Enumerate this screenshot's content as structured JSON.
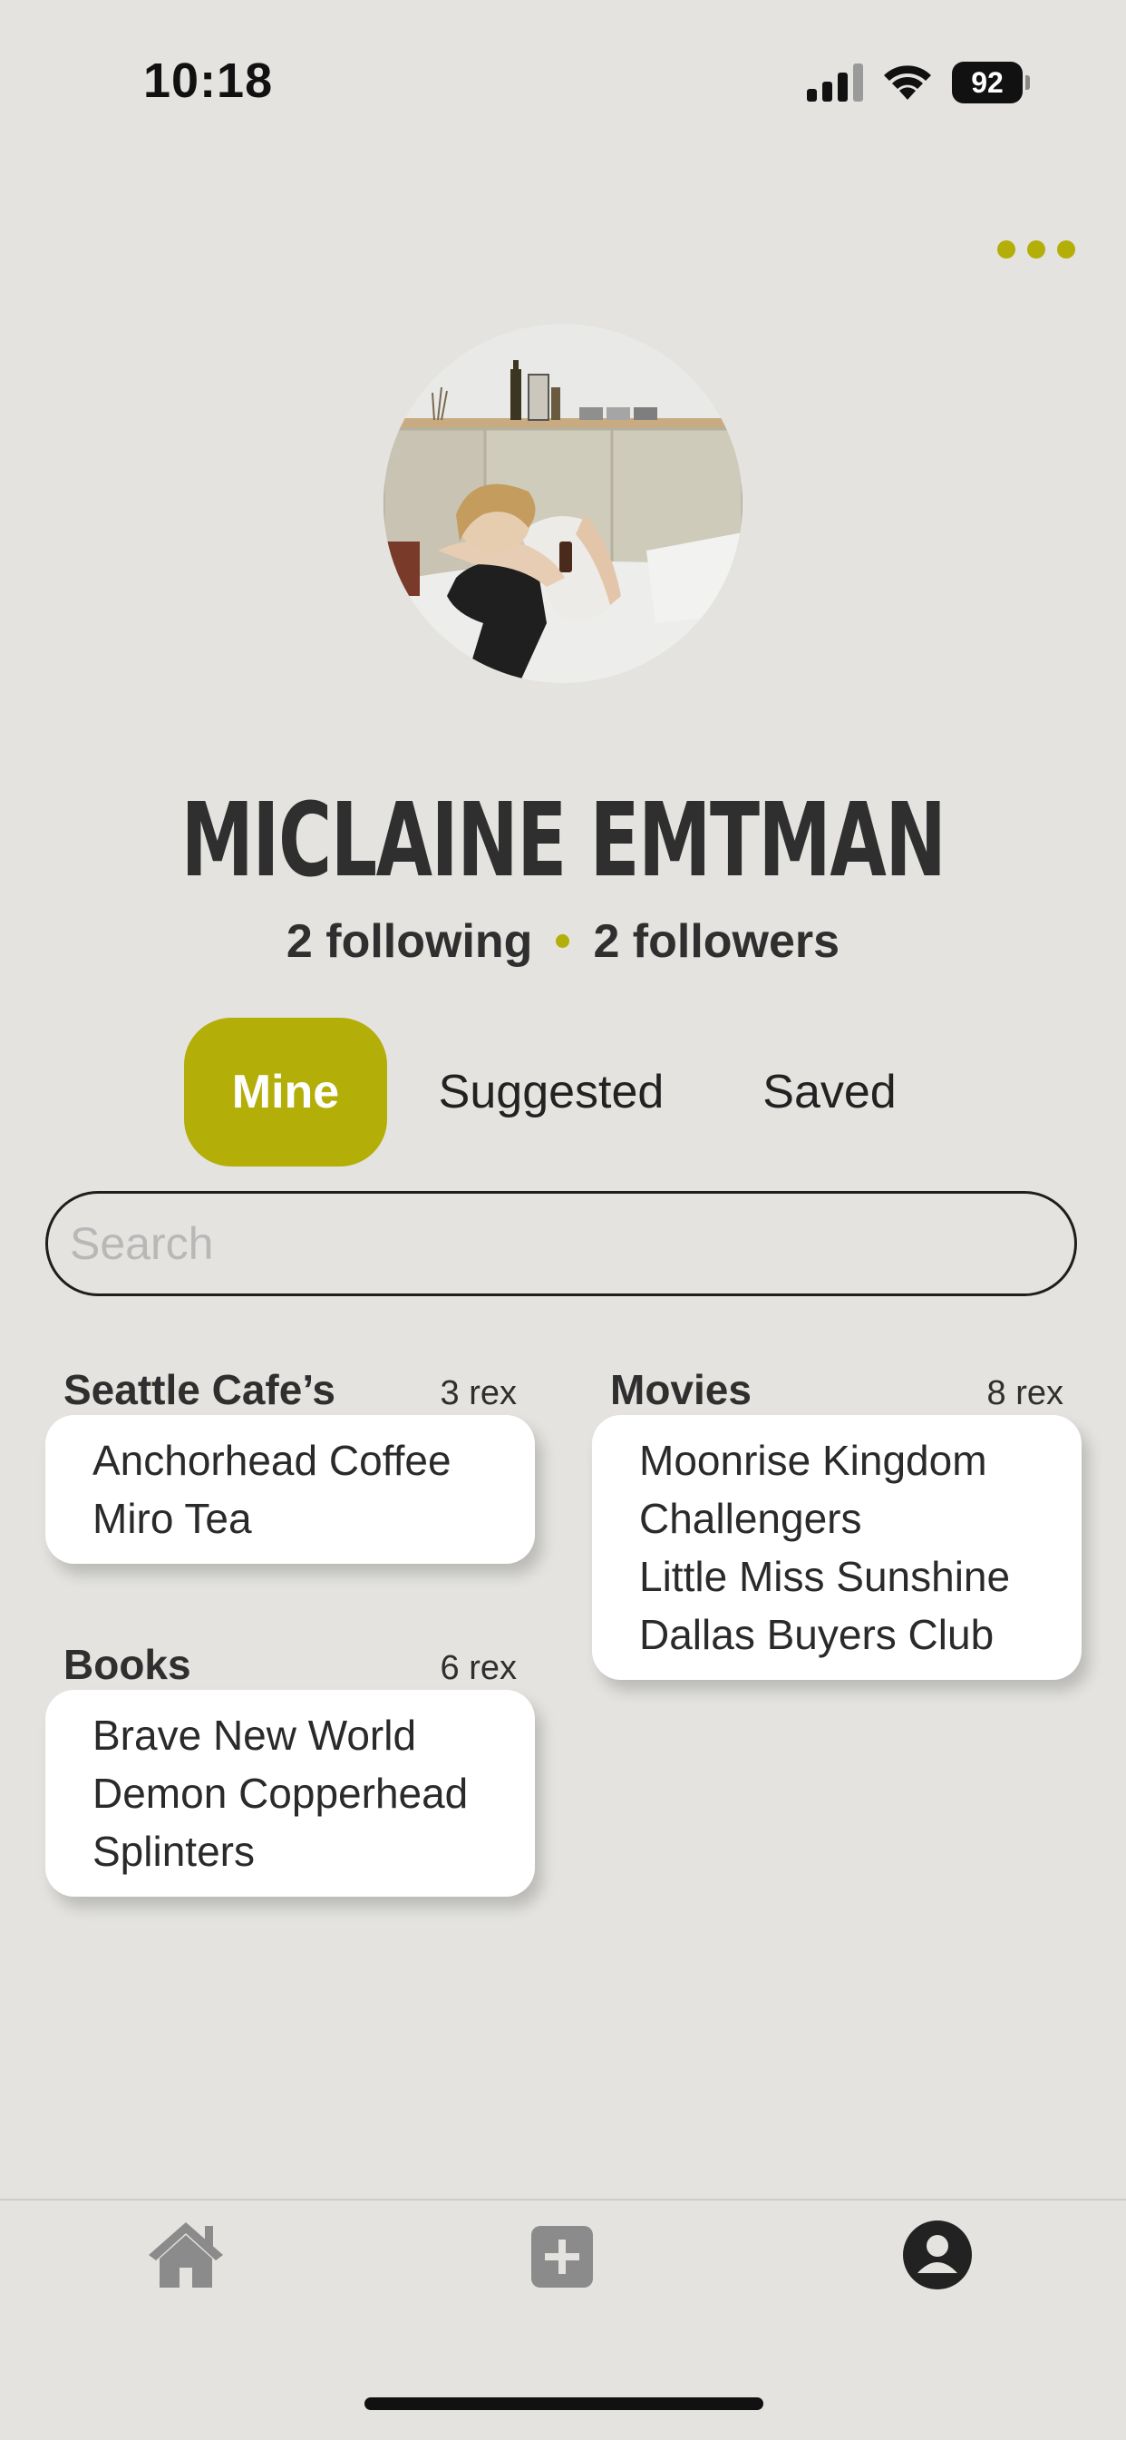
{
  "status_bar": {
    "time": "10:18",
    "battery": "92",
    "icons": [
      "signal-icon",
      "wifi-icon",
      "battery-icon"
    ]
  },
  "header": {
    "more_icon": "ellipsis-icon"
  },
  "profile": {
    "name": "MICLAINE EMTMAN",
    "following": "2 following",
    "followers": "2 followers"
  },
  "tabs": [
    {
      "label": "Mine",
      "active": true
    },
    {
      "label": "Suggested",
      "active": false
    },
    {
      "label": "Saved",
      "active": false
    }
  ],
  "search": {
    "placeholder": "Search",
    "value": ""
  },
  "collections": [
    {
      "title": "Seattle Cafe’s",
      "count": "3 rex",
      "items": [
        "Anchorhead Coffee",
        "Miro Tea"
      ]
    },
    {
      "title": "Movies",
      "count": "8 rex",
      "items": [
        "Moonrise Kingdom",
        "Challengers",
        "Little Miss Sunshine",
        "Dallas Buyers Club"
      ]
    },
    {
      "title": "Books",
      "count": "6 rex",
      "items": [
        "Brave New World",
        "Demon Copperhead",
        "Splinters"
      ]
    }
  ],
  "bottom_nav": {
    "items": [
      "home-icon",
      "add-icon",
      "profile-icon"
    ],
    "active": "profile-icon"
  },
  "colors": {
    "accent": "#b3ae08",
    "background": "#e4e3df",
    "card": "#ffffff",
    "text": "#2f2f2f"
  }
}
